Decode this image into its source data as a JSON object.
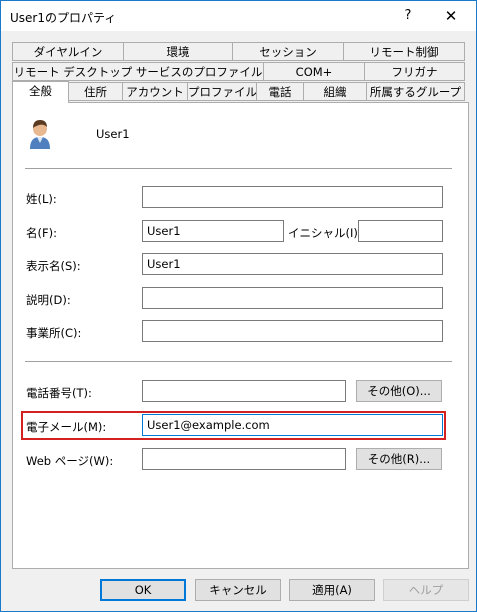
{
  "window": {
    "title": "User1のプロパティ",
    "help": "?",
    "close": "✕"
  },
  "tabs": {
    "row1": [
      "ダイヤルイン",
      "環境",
      "セッション",
      "リモート制御"
    ],
    "row2": [
      "リモート デスクトップ サービスのプロファイル",
      "COM+",
      "フリガナ"
    ],
    "row3": [
      "全般",
      "住所",
      "アカウント",
      "プロファイル",
      "電話",
      "組織",
      "所属するグループ"
    ]
  },
  "user": {
    "name": "User1",
    "icon": "user-icon"
  },
  "fields": {
    "last_name_label": "姓(L):",
    "last_name_value": "",
    "first_name_label": "名(F):",
    "first_name_value": "User1",
    "initials_label": "イニシャル(I):",
    "initials_value": "",
    "display_name_label": "表示名(S):",
    "display_name_value": "User1",
    "description_label": "説明(D):",
    "description_value": "",
    "office_label": "事業所(C):",
    "office_value": "",
    "phone_label": "電話番号(T):",
    "phone_value": "",
    "phone_other": "その他(O)...",
    "email_label": "電子メール(M):",
    "email_value": "User1@example.com",
    "web_label": "Web ページ(W):",
    "web_value": "",
    "web_other": "その他(R)..."
  },
  "buttons": {
    "ok": "OK",
    "cancel": "キャンセル",
    "apply": "適用(A)",
    "help": "ヘルプ"
  },
  "colors": {
    "highlight": "#d32020",
    "accent": "#0078d7"
  }
}
